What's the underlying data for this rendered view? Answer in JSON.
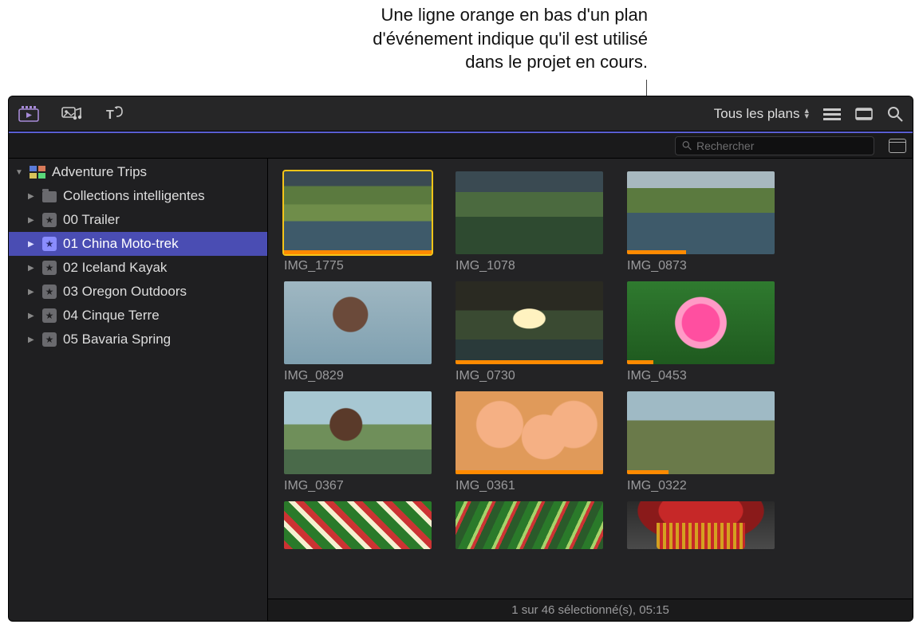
{
  "annotation": {
    "line1": "Une ligne orange en bas d'un plan",
    "line2": "d'événement indique qu'il est utilisé",
    "line3": "dans le projet en cours."
  },
  "toolbar": {
    "filter_label": "Tous les plans"
  },
  "filterbar": {
    "search_placeholder": "Rechercher"
  },
  "sidebar": {
    "library": "Adventure Trips",
    "items": [
      {
        "label": "Collections intelligentes",
        "type": "folder"
      },
      {
        "label": "00 Trailer",
        "type": "event"
      },
      {
        "label": "01 China Moto-trek",
        "type": "event",
        "selected": true
      },
      {
        "label": "02 Iceland Kayak",
        "type": "event"
      },
      {
        "label": "03 Oregon Outdoors",
        "type": "event"
      },
      {
        "label": "04 Cinque Terre",
        "type": "event"
      },
      {
        "label": "05 Bavaria Spring",
        "type": "event"
      }
    ]
  },
  "clips": [
    {
      "label": "IMG_1775",
      "orange_pct": 100,
      "selected": true
    },
    {
      "label": "IMG_1078",
      "orange_pct": 0
    },
    {
      "label": "IMG_0873",
      "orange_pct": 40
    },
    {
      "label": "IMG_0829",
      "orange_pct": 0
    },
    {
      "label": "IMG_0730",
      "orange_pct": 100
    },
    {
      "label": "IMG_0453",
      "orange_pct": 18
    },
    {
      "label": "IMG_0367",
      "orange_pct": 0
    },
    {
      "label": "IMG_0361",
      "orange_pct": 100
    },
    {
      "label": "IMG_0322",
      "orange_pct": 28
    },
    {
      "label": "",
      "orange_pct": 0
    },
    {
      "label": "",
      "orange_pct": 0
    },
    {
      "label": "",
      "orange_pct": 0
    }
  ],
  "status": "1 sur 46 sélectionné(s), 05:15"
}
